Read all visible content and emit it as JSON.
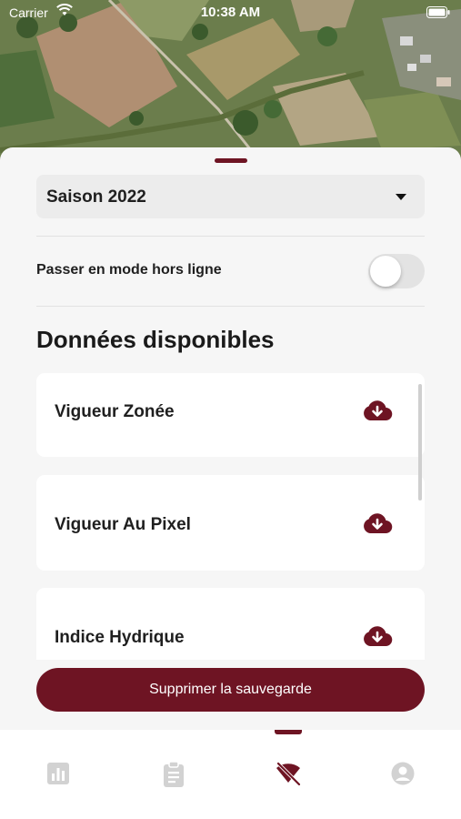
{
  "status_bar": {
    "carrier": "Carrier",
    "time": "10:38 AM",
    "wifi_icon": "wifi-icon",
    "battery_icon": "battery-icon"
  },
  "map": {
    "type": "satellite-imagery"
  },
  "sheet": {
    "season_select": {
      "value": "Saison 2022"
    },
    "offline_toggle": {
      "label": "Passer en mode hors ligne",
      "checked": false
    },
    "section_title": "Données disponibles",
    "datasets": [
      {
        "label": "Vigueur Zonée",
        "icon": "cloud-download-icon"
      },
      {
        "label": "Vigueur Au Pixel",
        "icon": "cloud-download-icon"
      },
      {
        "label": "Indice Hydrique",
        "icon": "cloud-download-icon"
      }
    ],
    "delete_button": "Supprimer la sauvegarde"
  },
  "tab_bar": {
    "tabs": [
      {
        "icon": "chart-icon",
        "active": false
      },
      {
        "icon": "clipboard-icon",
        "active": false
      },
      {
        "icon": "wifi-off-icon",
        "active": true
      },
      {
        "icon": "user-icon",
        "active": false
      }
    ]
  },
  "colors": {
    "accent": "#6e1423",
    "sheet_background": "#f6f6f6",
    "card_background": "#ffffff",
    "inactive_icon": "#d2d2d2"
  }
}
